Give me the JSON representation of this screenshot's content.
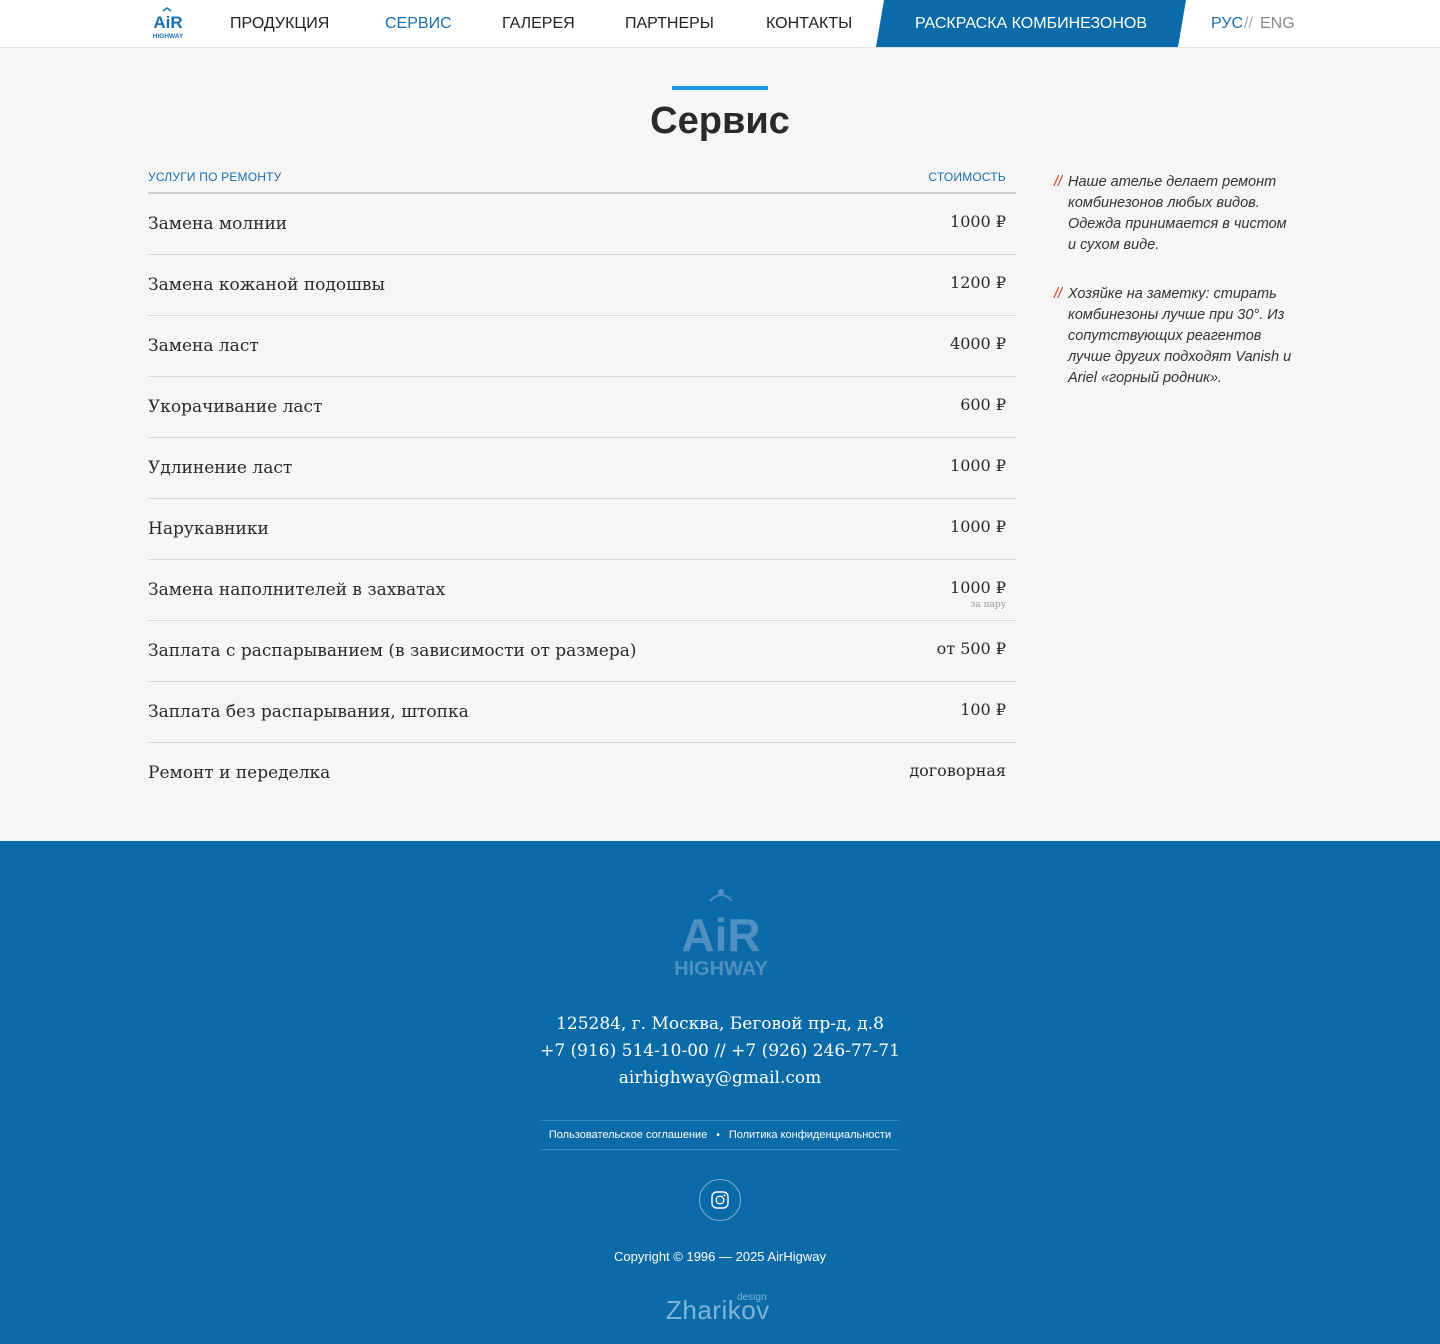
{
  "header": {
    "logo_top": "AiR",
    "logo_bottom": "HIGHWAY",
    "nav": [
      {
        "label": "ПРОДУКЦИЯ",
        "active": false
      },
      {
        "label": "СЕРВИС",
        "active": true
      },
      {
        "label": "ГАЛЕРЕЯ",
        "active": false
      },
      {
        "label": "ПАРТНЕРЫ",
        "active": false
      },
      {
        "label": "КОНТАКТЫ",
        "active": false
      }
    ],
    "highlight": "РАСКРАСКА КОМБИНЕЗОНОВ",
    "lang_ru": "РУС",
    "lang_sep": "//",
    "lang_en": "ENG"
  },
  "main": {
    "title": "Сервис",
    "col_services": "УСЛУГИ ПО РЕМОНТУ",
    "col_price": "СТОИМОСТЬ",
    "services": [
      {
        "name": "Замена молнии",
        "price": "1000 ₽",
        "note": ""
      },
      {
        "name": "Замена кожаной подошвы",
        "price": "1200 ₽",
        "note": ""
      },
      {
        "name": "Замена ласт",
        "price": "4000 ₽",
        "note": ""
      },
      {
        "name": "Укорачивание ласт",
        "price": "600 ₽",
        "note": ""
      },
      {
        "name": "Удлинение ласт",
        "price": "1000 ₽",
        "note": ""
      },
      {
        "name": "Нарукавники",
        "price": "1000 ₽",
        "note": ""
      },
      {
        "name": "Замена наполнителей в захватах",
        "price": "1000 ₽",
        "note": "за пару"
      },
      {
        "name": "Заплата с распарыванием (в зависимости от размера)",
        "price": "от 500 ₽",
        "note": ""
      },
      {
        "name": "Заплата без распарывания, штопка",
        "price": "100 ₽",
        "note": ""
      },
      {
        "name": "Ремонт и переделка",
        "price": "договорная",
        "note": ""
      }
    ],
    "side_mark": "//",
    "side_note_1": "Наше ателье делает ремонт комбинезонов любых видов. Одежда принимается в чистом и сухом виде.",
    "side_note_2": "Хозяйке на заметку: стирать комбинезоны лучше при 30°. Из сопутствующих реагентов лучше других подходят Vanish и Ariel «горный родник»."
  },
  "footer": {
    "logo_top": "AiR",
    "logo_bottom": "HIGHWAY",
    "address": "125284, г. Москва, Беговой пр-д, д.8",
    "phones": "+7 (916) 514-10-00 // +7 (926) 246-77-71",
    "email": "airhighway@gmail.com",
    "link_terms": "Пользовательское соглашение",
    "link_dot": "•",
    "link_privacy": "Политика конфиденциальности",
    "copyright": "Copyright © 1996 — 2025 AirHigway",
    "designer_name": "Zharikov",
    "designer_sup": "design"
  },
  "colors": {
    "accent": "#1a6fb0",
    "footer_bg": "#0b6ba8",
    "title_bar": "#1e9be8",
    "side_mark": "#c0392b"
  },
  "icons": [
    "logo-icon",
    "instagram-icon"
  ]
}
